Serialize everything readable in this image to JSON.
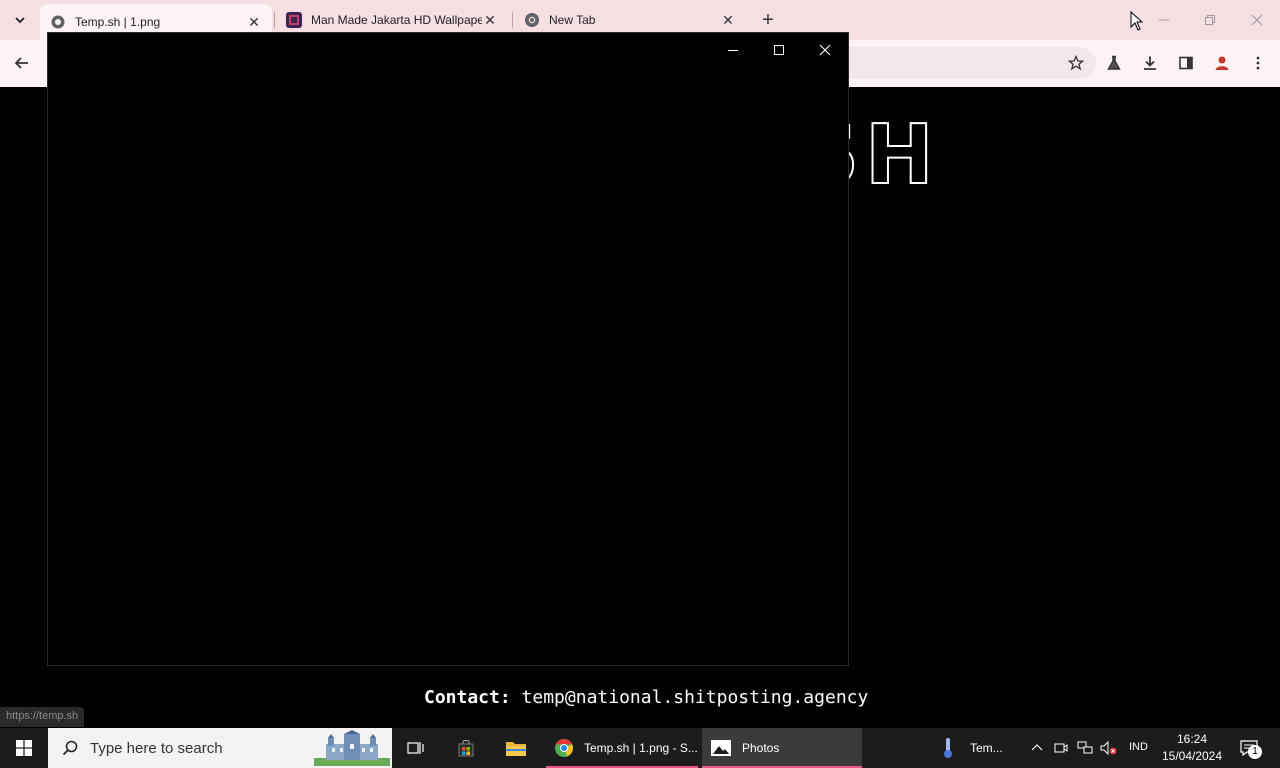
{
  "browser": {
    "tabs": [
      {
        "title": "Temp.sh | 1.png",
        "active": true
      },
      {
        "title": "Man Made Jakarta HD Wallpapers",
        "active": false
      },
      {
        "title": "New Tab",
        "active": false
      }
    ],
    "tab_close_glyph": "✕",
    "new_tab_glyph": "+",
    "icons": [
      "tab-search-icon",
      "back-arrow-icon",
      "star-icon",
      "flask-icon",
      "download-icon",
      "side-panel-icon",
      "profile-icon",
      "kebab-menu-icon",
      "minimize-icon",
      "restore-icon",
      "close-icon"
    ]
  },
  "page": {
    "logo_partial": "SH",
    "contact_label": "Contact:",
    "contact_email": "temp@national.shitposting.agency",
    "status_url": "https://temp.sh"
  },
  "photos_window": {
    "app": "Photos",
    "icons": [
      "minimize-icon",
      "maximize-icon",
      "close-icon"
    ]
  },
  "taskbar": {
    "search_placeholder": "Type here to search",
    "apps": [
      {
        "label": "Temp.sh | 1.png - S..."
      },
      {
        "label": "Photos"
      }
    ],
    "weather_label": "Tem...",
    "language": "IND",
    "time": "16:24",
    "date": "15/04/2024",
    "notification_count": "1"
  },
  "colors": {
    "tabstrip": "#f6dfe3",
    "toolbar": "#fdf3f4",
    "taskbar": "#1c1c1c",
    "accent_underline": "#e9547c"
  }
}
